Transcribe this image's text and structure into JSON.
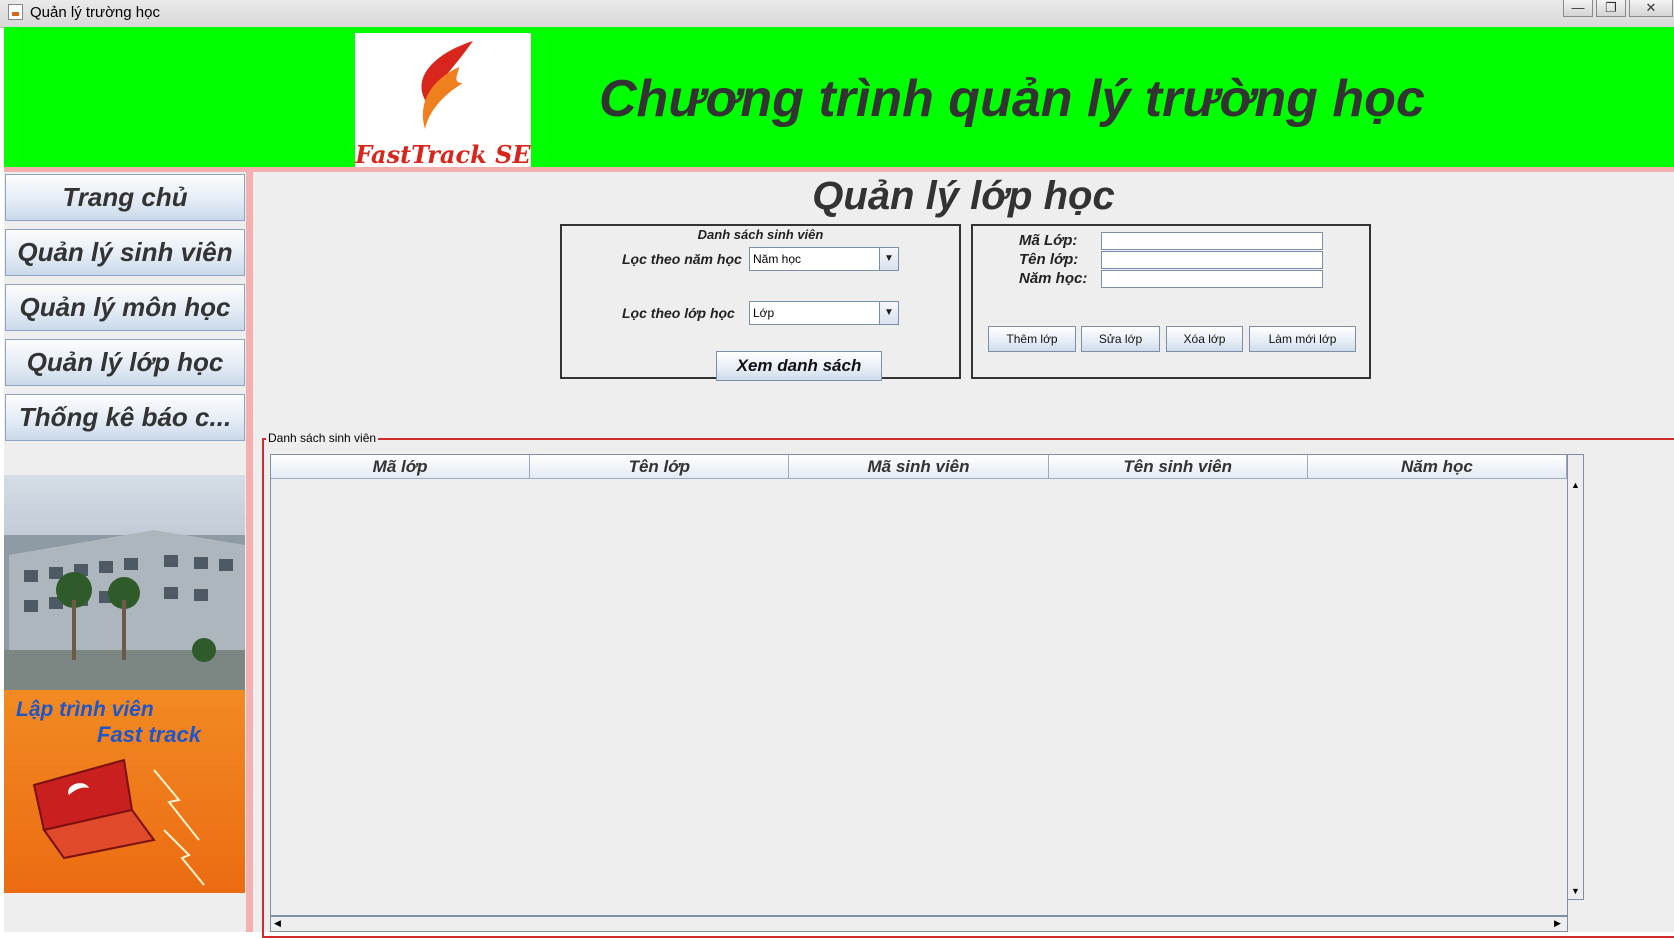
{
  "window": {
    "title": "Quản lý trường học",
    "minimize": "—",
    "maximize": "❐",
    "close": "✕"
  },
  "header": {
    "title": "Chương trình quản lý trường học",
    "logo_text": "FastTrack SE"
  },
  "sidebar": {
    "items": [
      {
        "label": "Trang chủ"
      },
      {
        "label": "Quản lý sinh viên"
      },
      {
        "label": "Quản lý môn học"
      },
      {
        "label": "Quản lý lớp học"
      },
      {
        "label": "Thống kê báo c..."
      }
    ],
    "promo_line1": "Lập trình viên",
    "promo_line2": "Fast track"
  },
  "main": {
    "title": "Quản lý lớp học",
    "filter": {
      "title": "Danh sách sinh viên",
      "year_label": "Lọc theo năm học",
      "year_value": "Năm học",
      "class_label": "Lọc theo lớp học",
      "class_value": "Lớp",
      "view_button": "Xem danh sách"
    },
    "form": {
      "ma_lop_label": "Mã Lớp:",
      "ten_lop_label": "Tên lớp:",
      "nam_hoc_label": "Năm học:",
      "ma_lop_value": "",
      "ten_lop_value": "",
      "nam_hoc_value": "",
      "add_button": "Thêm lớp",
      "edit_button": "Sửa lớp",
      "delete_button": "Xóa lớp",
      "refresh_button": "Làm mới lớp"
    },
    "list": {
      "title": "Danh sách sinh viên",
      "columns": [
        "Mã lớp",
        "Tên lớp",
        "Mã sinh viên",
        "Tên sinh viên",
        "Năm học"
      ],
      "rows": []
    }
  },
  "colors": {
    "header_bg": "#00ff00",
    "accent_border": "#d12b2b",
    "band": "#f4b0b0"
  }
}
